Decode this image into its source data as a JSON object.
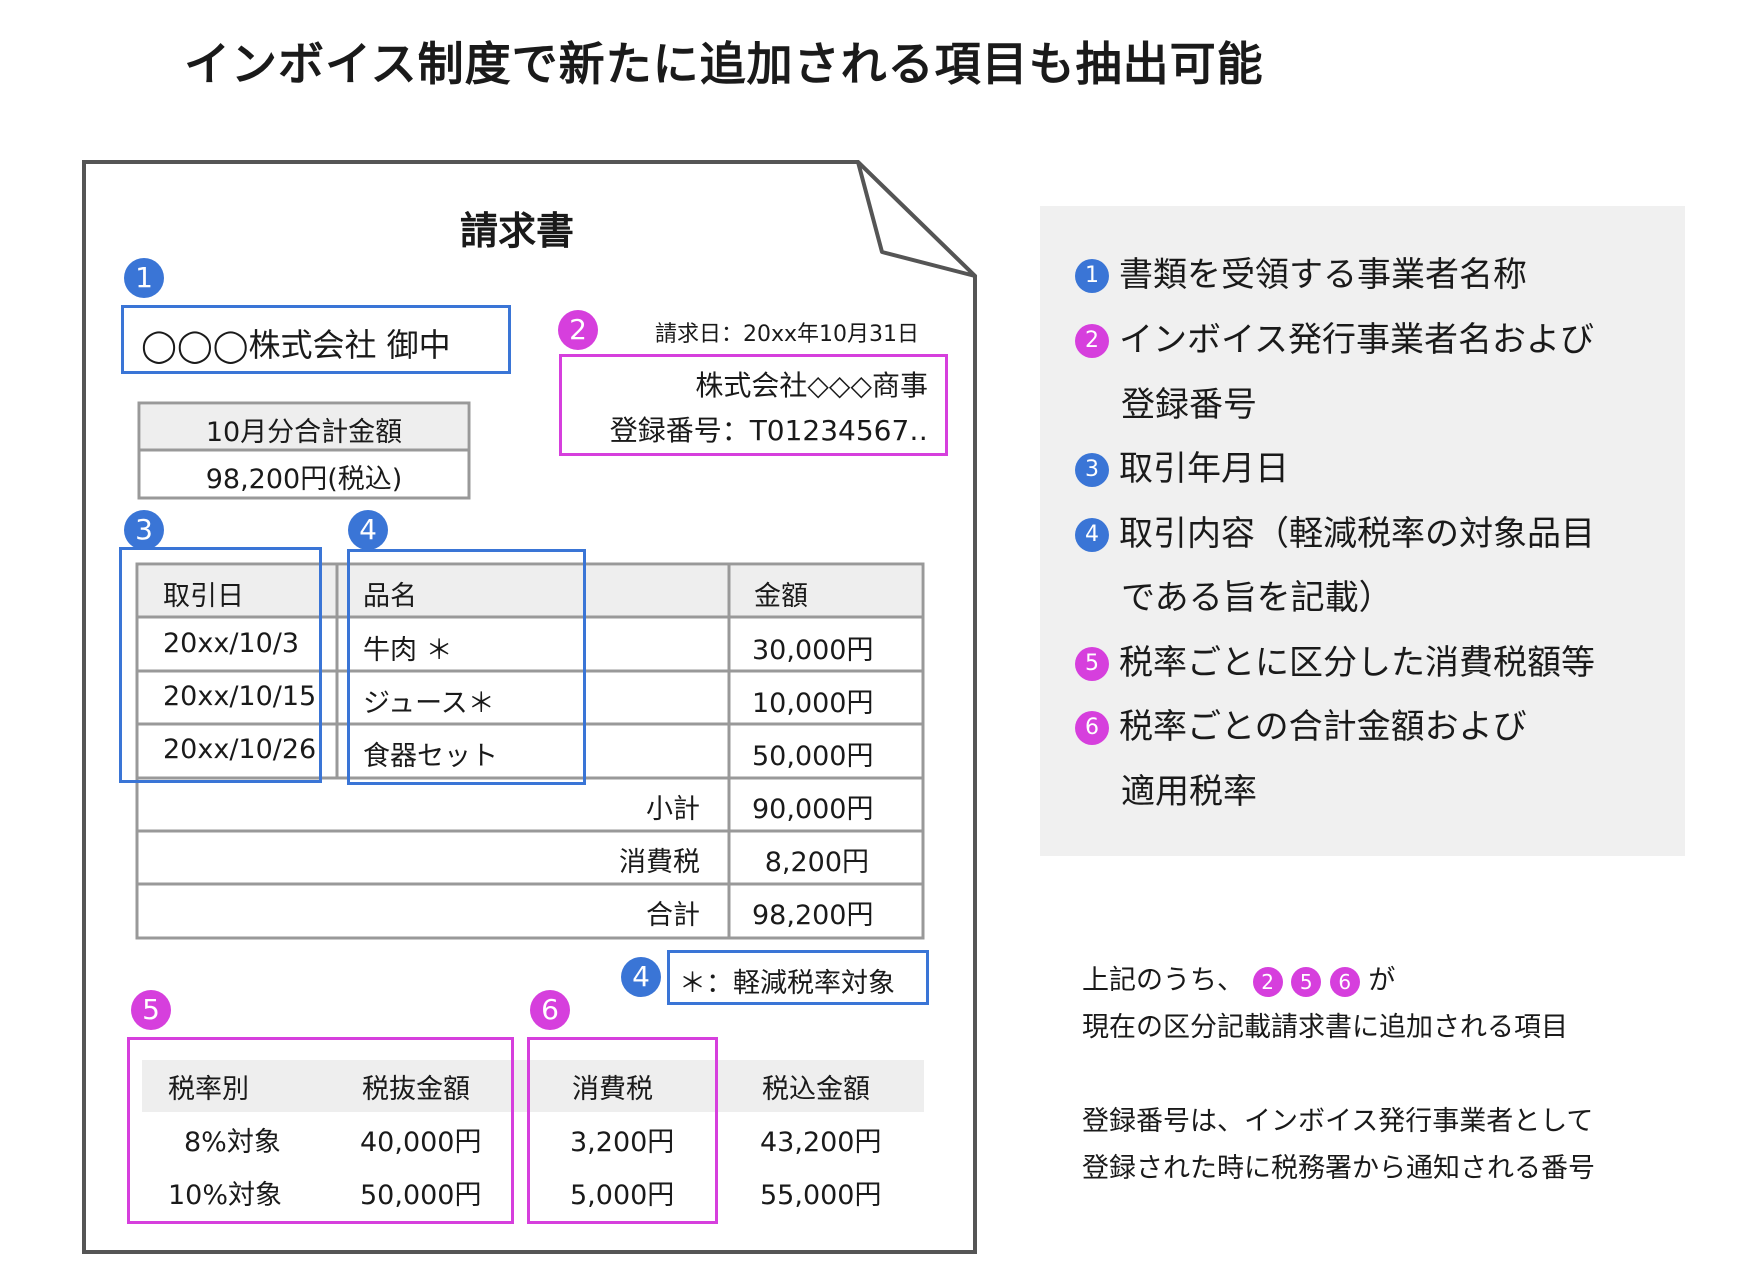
{
  "title": "インボイス制度で新たに追加される項目も抽出可能",
  "invoice": {
    "heading": "請求書",
    "recipient": "◯◯◯株式会社 御中",
    "issue_date": "請求日：20xx年10月31日",
    "issuer_name": "株式会社◇◇◇商事",
    "registration": "登録番号：T01234567‥",
    "total_box": {
      "label": "10月分合計金額",
      "value": "98,200円(税込)"
    },
    "table": {
      "headers": [
        "取引日",
        "品名",
        "金額"
      ],
      "rows": [
        {
          "date": "20xx/10/3",
          "item": "牛肉 ＊",
          "amount": "30,000円"
        },
        {
          "date": "20xx/10/15",
          "item": "ジュース＊",
          "amount": "10,000円"
        },
        {
          "date": "20xx/10/26",
          "item": "食器セット",
          "amount": "50,000円"
        }
      ],
      "subtotal_label": "小計",
      "subtotal": "90,000円",
      "tax_label": "消費税",
      "tax": "8,200円",
      "total_label": "合計",
      "total": "98,200円"
    },
    "reduced_note": "＊：軽減税率対象",
    "tax_table": {
      "headers": [
        "税率別",
        "税抜金額",
        "消費税",
        "税込金額"
      ],
      "rows": [
        [
          "8%対象",
          "40,000円",
          "3,200円",
          "43,200円"
        ],
        [
          "10%対象",
          "50,000円",
          "5,000円",
          "55,000円"
        ]
      ]
    }
  },
  "badges": [
    "1",
    "2",
    "3",
    "4",
    "4",
    "5",
    "6"
  ],
  "legend": [
    {
      "num": "1",
      "color": "blue",
      "lines": [
        "書類を受領する事業者名称"
      ]
    },
    {
      "num": "2",
      "color": "pink",
      "lines": [
        "インボイス発行事業者名および",
        "登録番号"
      ]
    },
    {
      "num": "3",
      "color": "blue",
      "lines": [
        "取引年月日"
      ]
    },
    {
      "num": "4",
      "color": "blue",
      "lines": [
        "取引内容（軽減税率の対象品目",
        "である旨を記載）"
      ]
    },
    {
      "num": "5",
      "color": "pink",
      "lines": [
        "税率ごとに区分した消費税額等"
      ]
    },
    {
      "num": "6",
      "color": "pink",
      "lines": [
        "税率ごとの合計金額および",
        "適用税率"
      ]
    }
  ],
  "notes": {
    "line1_pre": "上記のうち、",
    "line1_badges": [
      "2",
      "5",
      "6"
    ],
    "line1_post": "が",
    "line2": "現在の区分記載請求書に追加される項目",
    "line3": "登録番号は、インボイス発行事業者として",
    "line4": "登録された時に税務署から通知される番号"
  },
  "colors": {
    "blue": "#3a75d6",
    "pink": "#d63fdd",
    "panel": "#f0f0f0",
    "grid": "#999999"
  }
}
